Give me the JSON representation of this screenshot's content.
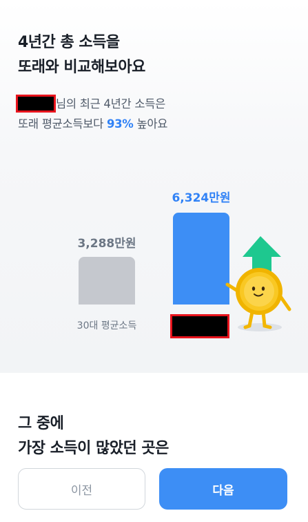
{
  "header": {
    "title_line1": "4년간 총 소득을",
    "title_line2": "또래와 비교해보아요"
  },
  "summary": {
    "line1_suffix": "님의 최근 4년간 소득은",
    "line2_prefix": "또래 평균소득보다 ",
    "percent": "93%",
    "line2_suffix": " 높아요"
  },
  "comparison": {
    "average": {
      "value": "3,288만원",
      "label": "30대 평균소득",
      "amount": 3288
    },
    "mine": {
      "value": "6,324만원",
      "amount": 6324
    }
  },
  "section": {
    "line1": "그 중에",
    "line2": "가장 소득이 많았던 곳은"
  },
  "buttons": {
    "prev": "이전",
    "next": "다음"
  },
  "colors": {
    "accent": "#3182f6",
    "bar_mine": "#3d8ef5",
    "bar_average": "#c5c8ce",
    "coin": "#f9c823",
    "arrow": "#1ec88f"
  }
}
